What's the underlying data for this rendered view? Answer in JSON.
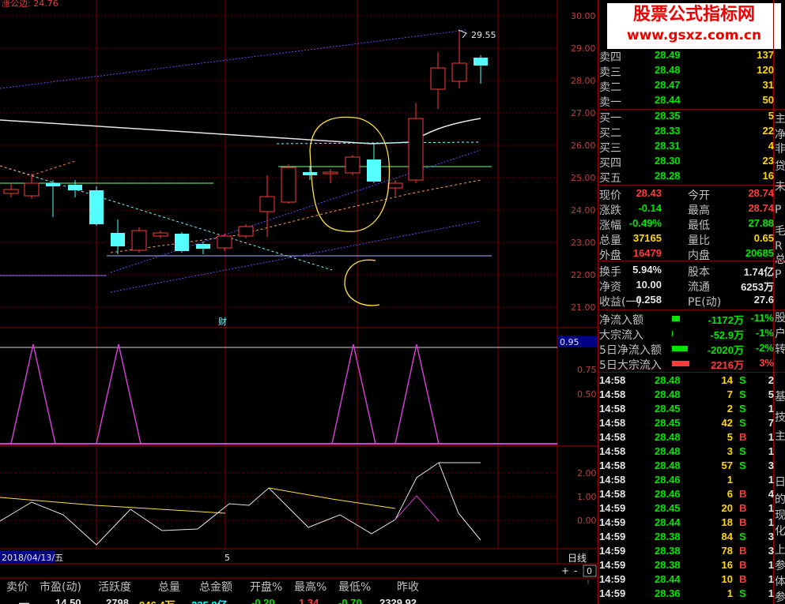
{
  "top_label": "涨公边: 24.76",
  "watermark": {
    "title": "股票公式指标网",
    "url": "www.gsxz.com.cn"
  },
  "price_axis": [
    "30.00",
    "29.00",
    "28.00",
    "27.00",
    "26.00",
    "25.00",
    "24.00",
    "23.00",
    "22.00",
    "21.00"
  ],
  "osc_axis": [
    "0.95",
    "0.75",
    "0.50"
  ],
  "macd_axis": [
    "2.00",
    "1.00",
    "0.00"
  ],
  "high_marker": "29.55",
  "cai_marker": "财",
  "date_label": "2018/04/13/五",
  "cursor_label": "5",
  "period_label": "日线",
  "zoom_plus": "+",
  "zoom_minus": "-",
  "zoom_value": "0",
  "order_book": [
    {
      "label": "卖四",
      "price": "28.49",
      "vol": "137"
    },
    {
      "label": "卖三",
      "price": "28.48",
      "vol": "120"
    },
    {
      "label": "卖二",
      "price": "28.47",
      "vol": "31"
    },
    {
      "label": "卖一",
      "price": "28.44",
      "vol": "50"
    },
    {
      "label": "买一",
      "price": "28.35",
      "vol": "5"
    },
    {
      "label": "买二",
      "price": "28.33",
      "vol": "22"
    },
    {
      "label": "买三",
      "price": "28.31",
      "vol": "4"
    },
    {
      "label": "买四",
      "price": "28.30",
      "vol": "23"
    },
    {
      "label": "买五",
      "price": "28.28",
      "vol": "16"
    }
  ],
  "stats": [
    {
      "l1": "现价",
      "v1": "28.43",
      "c1": "red",
      "l2": "今开",
      "v2": "28.74",
      "c2": "red"
    },
    {
      "l1": "涨跌",
      "v1": "-0.14",
      "c1": "green",
      "l2": "最高",
      "v2": "28.74",
      "c2": "red"
    },
    {
      "l1": "涨幅",
      "v1": "-0.49%",
      "c1": "green",
      "l2": "最低",
      "v2": "27.88",
      "c2": "green"
    },
    {
      "l1": "总量",
      "v1": "37165",
      "c1": "yellow",
      "l2": "量比",
      "v2": "0.65",
      "c2": "yellow"
    },
    {
      "l1": "外盘",
      "v1": "16479",
      "c1": "red",
      "l2": "内盘",
      "v2": "20685",
      "c2": "green"
    },
    {
      "l1": "换手",
      "v1": "5.94%",
      "c1": "white",
      "l2": "股本",
      "v2": "1.74亿",
      "c2": "white"
    },
    {
      "l1": "净资",
      "v1": "10.00",
      "c1": "white",
      "l2": "流通",
      "v2": "6253万",
      "c2": "white"
    },
    {
      "l1": "收益(一)",
      "v1": "0.258",
      "c1": "white",
      "l2": "PE(动)",
      "v2": "27.6",
      "c2": "white"
    }
  ],
  "fund_flow": [
    {
      "label": "净流入额",
      "value": "-1172万",
      "pct": "-11%",
      "color": "green"
    },
    {
      "label": "大宗流入",
      "value": "-52.9万",
      "pct": "-1%",
      "color": "green"
    },
    {
      "label": "5日净流入额",
      "value": "-2020万",
      "pct": "-2%",
      "color": "green"
    },
    {
      "label": "5日大宗流入",
      "value": "2216万",
      "pct": "3%",
      "color": "red"
    }
  ],
  "ticks": [
    {
      "time": "14:58",
      "price": "28.48",
      "vol": "14",
      "side": "S",
      "n": "2"
    },
    {
      "time": "14:58",
      "price": "28.48",
      "vol": "7",
      "side": "S",
      "n": "5"
    },
    {
      "time": "14:58",
      "price": "28.45",
      "vol": "2",
      "side": "S",
      "n": "1"
    },
    {
      "time": "14:58",
      "price": "28.45",
      "vol": "42",
      "side": "S",
      "n": "7"
    },
    {
      "time": "14:58",
      "price": "28.48",
      "vol": "5",
      "side": "B",
      "n": "1"
    },
    {
      "time": "14:58",
      "price": "28.48",
      "vol": "3",
      "side": "S",
      "n": "1"
    },
    {
      "time": "14:58",
      "price": "28.48",
      "vol": "57",
      "side": "S",
      "n": "3"
    },
    {
      "time": "14:58",
      "price": "28.46",
      "vol": "1",
      "side": "",
      "n": "1"
    },
    {
      "time": "14:58",
      "price": "28.46",
      "vol": "6",
      "side": "B",
      "n": "4"
    },
    {
      "time": "14:59",
      "price": "28.45",
      "vol": "20",
      "side": "B",
      "n": "1"
    },
    {
      "time": "14:59",
      "price": "28.44",
      "vol": "18",
      "side": "B",
      "n": "1"
    },
    {
      "time": "14:59",
      "price": "28.38",
      "vol": "84",
      "side": "S",
      "n": "3"
    },
    {
      "time": "14:59",
      "price": "28.38",
      "vol": "78",
      "side": "B",
      "n": "3"
    },
    {
      "time": "14:59",
      "price": "28.38",
      "vol": "16",
      "side": "B",
      "n": "1"
    },
    {
      "time": "14:59",
      "price": "28.44",
      "vol": "10",
      "side": "B",
      "n": "1"
    },
    {
      "time": "14:59",
      "price": "28.36",
      "vol": "1",
      "side": "S",
      "n": "1"
    }
  ],
  "edge_chars": [
    "主",
    "净",
    "非",
    "贷",
    "未",
    "P",
    "毛",
    "R",
    "总",
    "P",
    "股",
    "户",
    "转",
    "基",
    "技",
    "主",
    "日",
    "的",
    "现",
    "化",
    "上",
    "参",
    "体",
    "参"
  ],
  "bottom_headers": [
    "卖价",
    "市盈(动)",
    "活跃度",
    "总量",
    "总金额",
    "开盘%",
    "最高%",
    "最低%",
    "昨收"
  ],
  "bottom_values": [
    {
      "v": "—",
      "c": "white"
    },
    {
      "v": "14.50",
      "c": "white"
    },
    {
      "v": "2798",
      "c": "white"
    },
    {
      "v": "946.4万",
      "c": "yellow"
    },
    {
      "v": "235.8亿",
      "c": "cyan"
    },
    {
      "v": "-0.20",
      "c": "green"
    },
    {
      "v": "1.34",
      "c": "red"
    },
    {
      "v": "-0.70",
      "c": "green"
    },
    {
      "v": "2329.92",
      "c": "white"
    }
  ],
  "colors": {
    "up": "#ff3c3c",
    "down": "#54ffff",
    "grid": "#7b0000",
    "ma_white": "#e6e6e6",
    "ma_yellow": "#ffd24a",
    "purple": "#d040d0"
  }
}
